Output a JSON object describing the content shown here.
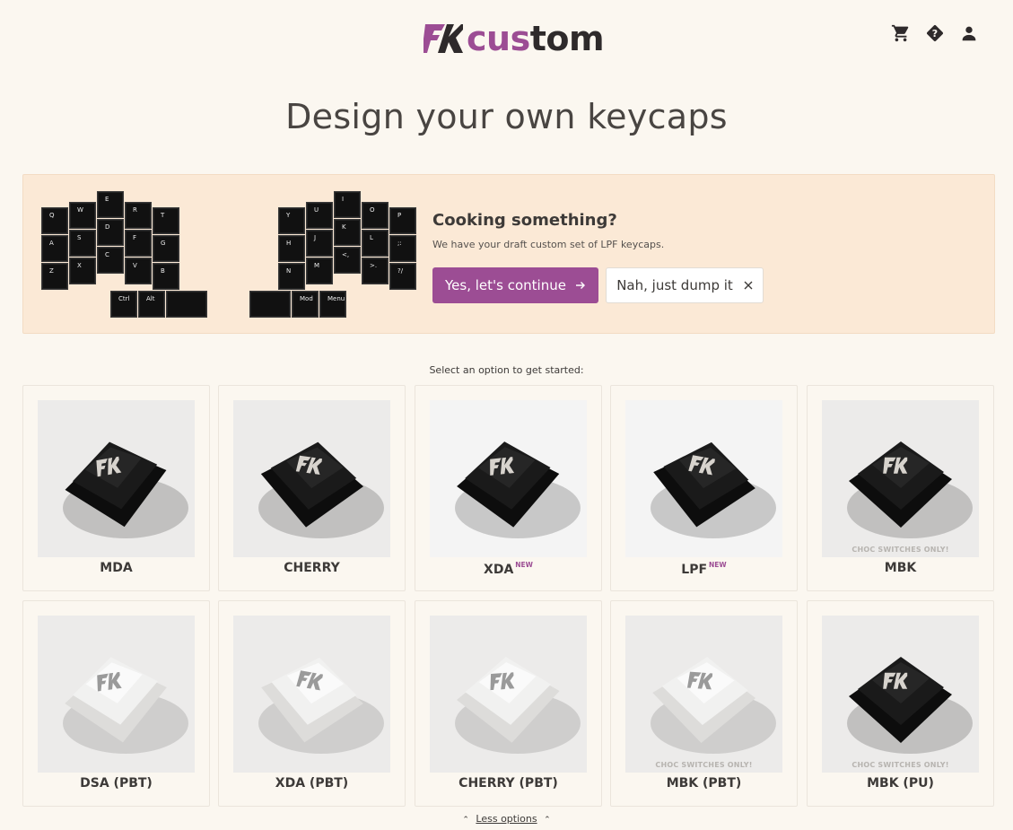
{
  "brand": {
    "name_part1": "cus",
    "name_part2": "tom",
    "accent": "#9c4d94"
  },
  "header": {
    "icons": [
      "cart-icon",
      "help-icon",
      "account-icon"
    ]
  },
  "title": "Design your own keycaps",
  "draft": {
    "title": "Cooking something?",
    "subtitle": "We have your draft custom set of LPF keycaps.",
    "continue_label": "Yes, let's continue",
    "dump_label": "Nah, just dump it",
    "left_keys": [
      "Q",
      "W",
      "E",
      "R",
      "T",
      "A",
      "S",
      "D",
      "F",
      "G",
      "Z",
      "X",
      "C",
      "V",
      "B",
      "Ctrl",
      "Alt"
    ],
    "right_keys": [
      "Y",
      "U",
      "I",
      "O",
      "P",
      "H",
      "J",
      "K",
      "L",
      ";:",
      "N",
      "M",
      "<,",
      ">.",
      "?/",
      "Mod",
      "Menu"
    ]
  },
  "select_hint": "Select an option to get started:",
  "options": [
    {
      "label": "MDA",
      "new": "",
      "choc": "",
      "cap": "black"
    },
    {
      "label": "CHERRY",
      "new": "",
      "choc": "",
      "cap": "black"
    },
    {
      "label": "XDA",
      "new": "NEW",
      "choc": "",
      "cap": "black"
    },
    {
      "label": "LPF",
      "new": "NEW",
      "choc": "",
      "cap": "black"
    },
    {
      "label": "MBK",
      "new": "",
      "choc": "CHOC SWITCHES ONLY!",
      "cap": "black"
    },
    {
      "label": "DSA (PBT)",
      "new": "",
      "choc": "",
      "cap": "white"
    },
    {
      "label": "XDA (PBT)",
      "new": "",
      "choc": "",
      "cap": "white"
    },
    {
      "label": "CHERRY (PBT)",
      "new": "",
      "choc": "",
      "cap": "white"
    },
    {
      "label": "MBK (PBT)",
      "new": "",
      "choc": "CHOC SWITCHES ONLY!",
      "cap": "white"
    },
    {
      "label": "MBK (PU)",
      "new": "",
      "choc": "CHOC SWITCHES ONLY!",
      "cap": "black"
    }
  ],
  "less_options": "Less options"
}
